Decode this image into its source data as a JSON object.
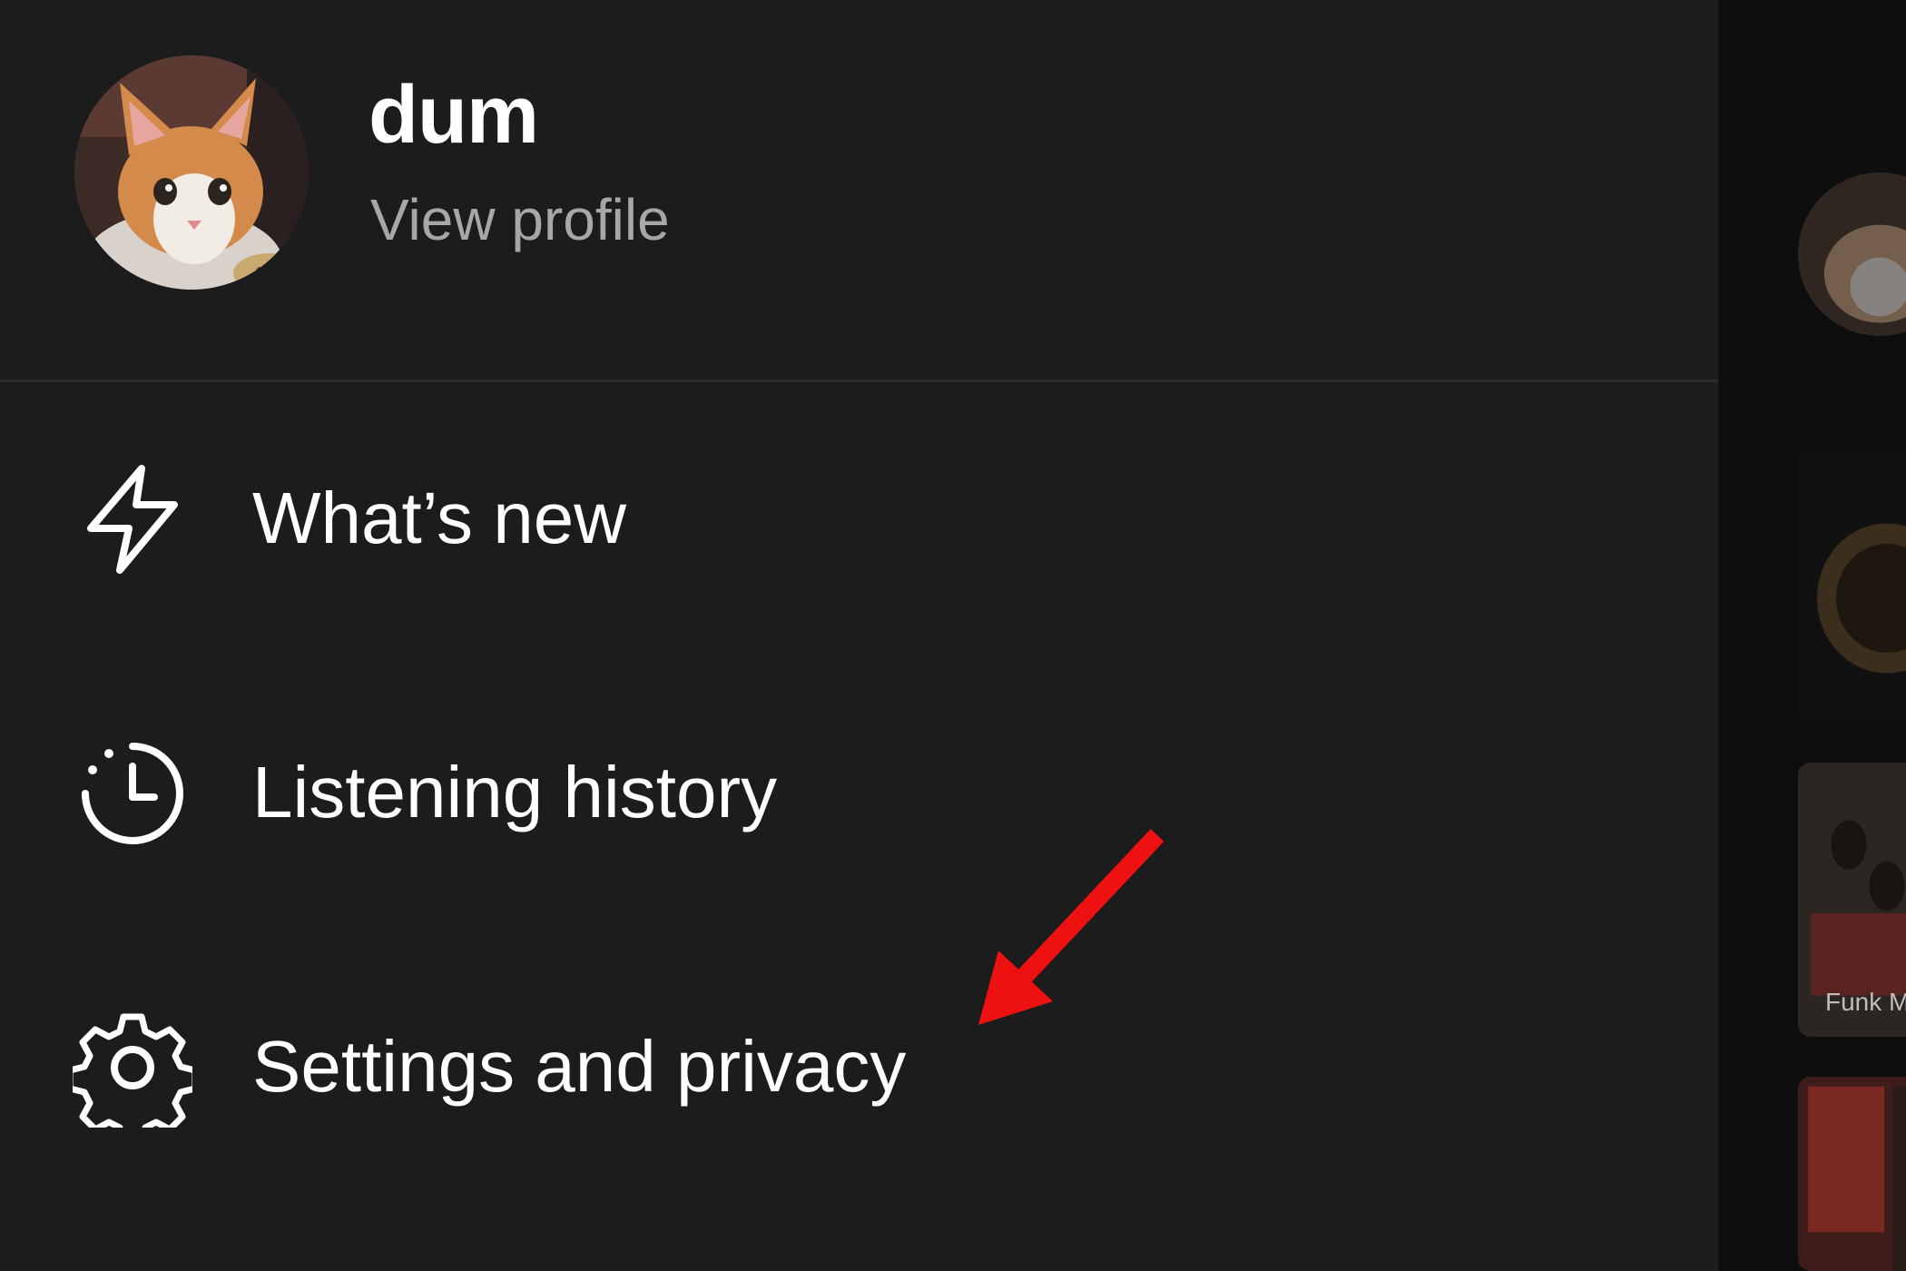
{
  "profile": {
    "name": "dum",
    "view_profile_label": "View profile",
    "avatar_icon": "kitten-avatar"
  },
  "menu": {
    "items": [
      {
        "label": "What’s new",
        "icon": "lightning-bolt-icon"
      },
      {
        "label": "Listening history",
        "icon": "history-clock-icon"
      },
      {
        "label": "Settings and privacy",
        "icon": "gear-icon"
      }
    ]
  },
  "annotation": {
    "arrow_color": "#ee1111",
    "points_to": "Settings and privacy"
  },
  "background": {
    "partial_card_caption": "Funk M"
  },
  "colors": {
    "drawer_bg": "#1c1c1c",
    "text_primary": "#ffffff",
    "text_secondary": "#a7a7a7",
    "divider": "#2e2e2e",
    "annotation_red": "#ee1111"
  }
}
